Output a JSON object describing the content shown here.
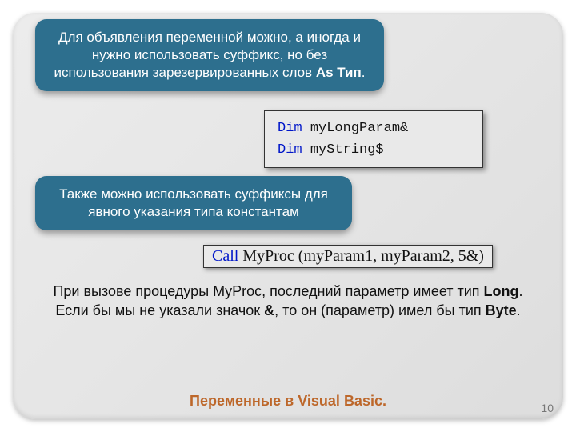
{
  "callout1": {
    "prefix": "Для объявления переменной можно, а иногда и нужно использовать суффикс, но без использования зарезервированных слов ",
    "bold": "As Тип",
    "suffix": "."
  },
  "code": {
    "kw": "Dim",
    "line1_ident": "myLongParam&",
    "line2_ident": "myString$"
  },
  "callout2": {
    "text": "Также можно использовать суффиксы для явного указания типа константам"
  },
  "call_line": {
    "kw": "Call",
    "rest": " MyProc (myParam1, myParam2, 5&)"
  },
  "body": {
    "l1a": "При вызове процедуры MyProc, последний параметр имеет тип ",
    "l1b": "Long",
    "l1c": ".",
    "l2a": "Если бы мы не указали значок ",
    "l2b": "&",
    "l2c": ", то он (параметр) имел бы тип ",
    "l2d": "Byte",
    "l2e": "."
  },
  "footer": "Переменные в Visual Basic.",
  "page": "10"
}
